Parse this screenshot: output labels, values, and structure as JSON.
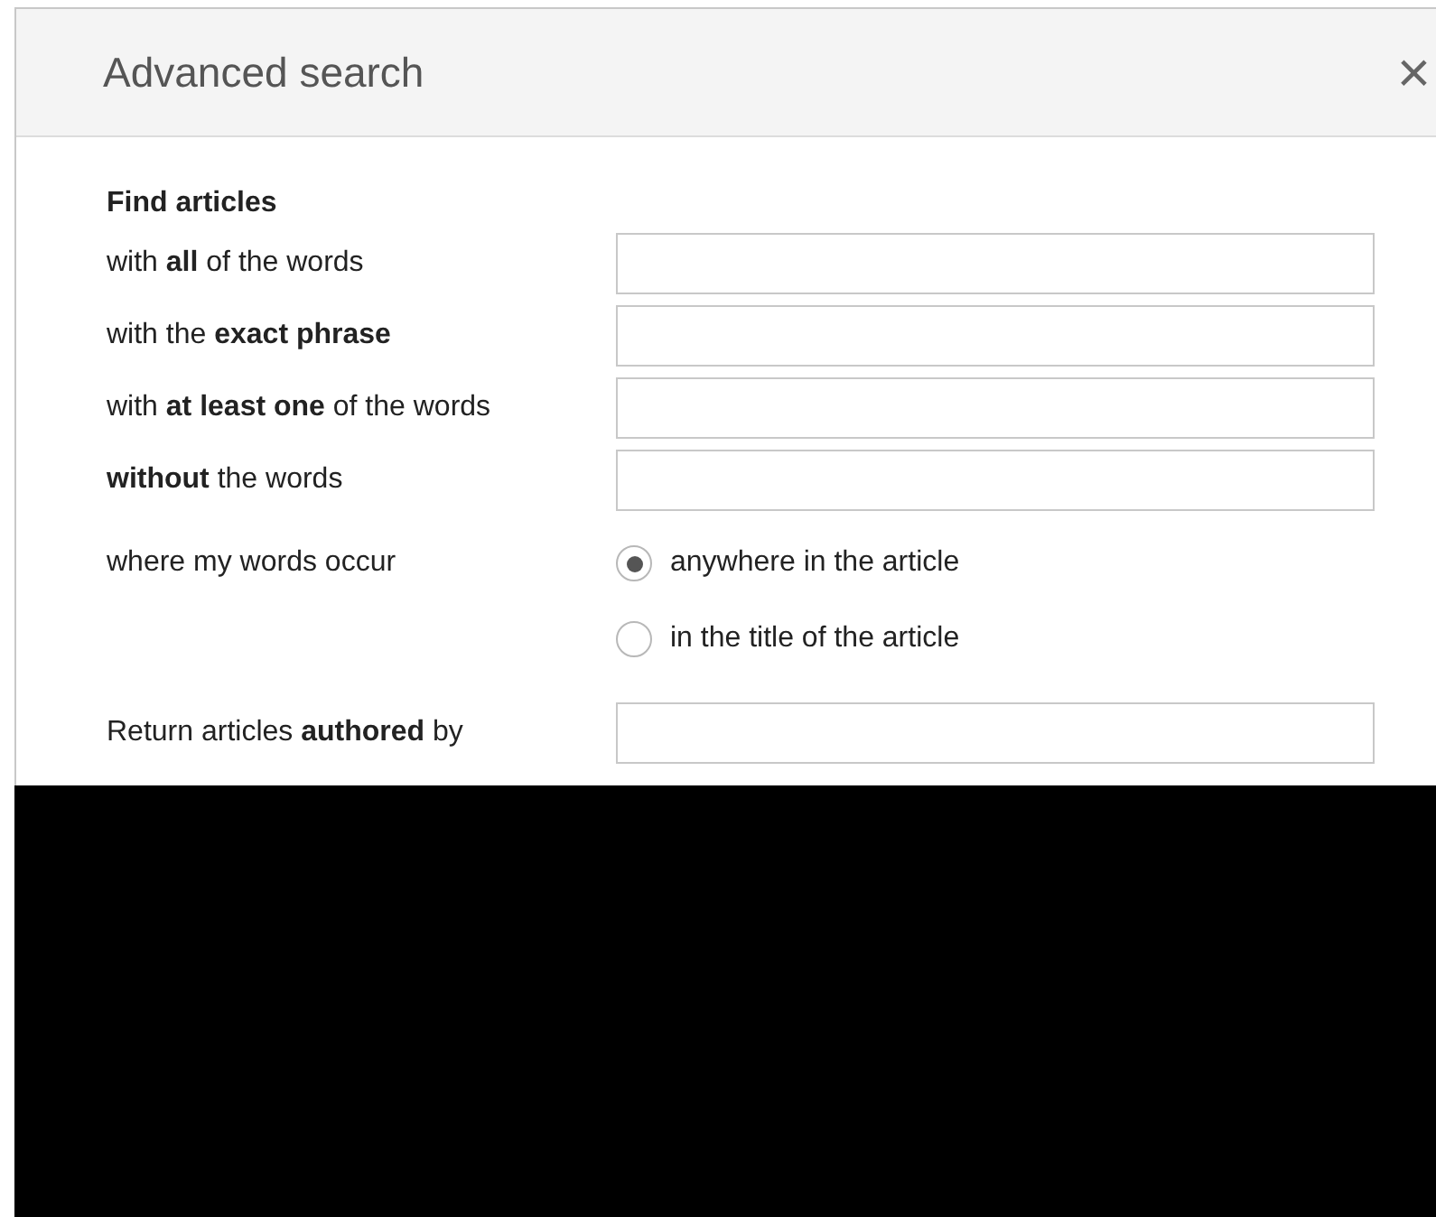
{
  "dialog": {
    "title": "Advanced search",
    "close": "×"
  },
  "section_heading": "Find articles",
  "rows": [
    {
      "kind": "text",
      "label": "with **all** of the words"
    },
    {
      "kind": "text",
      "label": "with the **exact phrase**"
    },
    {
      "kind": "text",
      "label": "with **at least one** of the words"
    },
    {
      "kind": "text",
      "label": "**without** the words"
    },
    {
      "kind": "radio",
      "label": "where my words occur",
      "options": [
        {
          "label": "anywhere in the article",
          "selected": true
        },
        {
          "label": "in the title of the article",
          "selected": false
        }
      ]
    },
    {
      "kind": "text",
      "label": "Return articles **authored** by"
    }
  ]
}
